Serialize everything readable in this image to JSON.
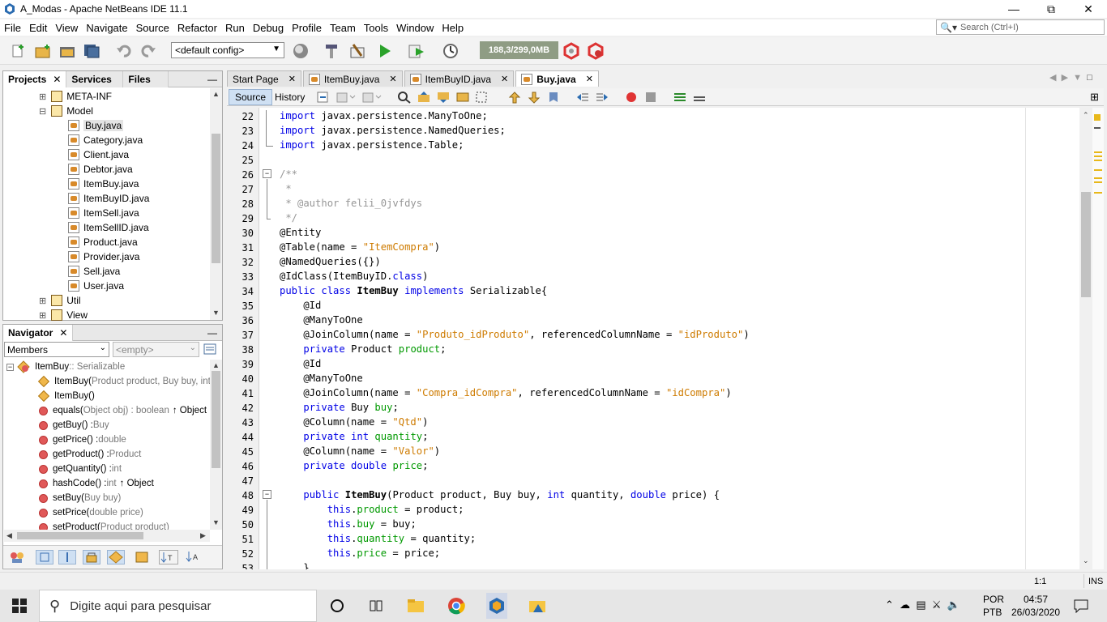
{
  "window": {
    "title": "A_Modas - Apache NetBeans IDE 11.1"
  },
  "menu": [
    "File",
    "Edit",
    "View",
    "Navigate",
    "Source",
    "Refactor",
    "Run",
    "Debug",
    "Profile",
    "Team",
    "Tools",
    "Window",
    "Help"
  ],
  "search": {
    "placeholder": "Search (Ctrl+I)"
  },
  "toolbar": {
    "config": "<default config>",
    "memory": "188,3/299,0MB"
  },
  "projects": {
    "tabs": [
      "Projects",
      "Services",
      "Files"
    ],
    "tree": [
      {
        "label": "META-INF",
        "type": "folder",
        "indent": 1
      },
      {
        "label": "Model",
        "type": "folder",
        "indent": 1
      },
      {
        "label": "Buy.java",
        "type": "java",
        "indent": 2,
        "selected": true
      },
      {
        "label": "Category.java",
        "type": "java",
        "indent": 2
      },
      {
        "label": "Client.java",
        "type": "java",
        "indent": 2
      },
      {
        "label": "Debtor.java",
        "type": "java",
        "indent": 2
      },
      {
        "label": "ItemBuy.java",
        "type": "java",
        "indent": 2
      },
      {
        "label": "ItemBuyID.java",
        "type": "java",
        "indent": 2
      },
      {
        "label": "ItemSell.java",
        "type": "java",
        "indent": 2
      },
      {
        "label": "ItemSellID.java",
        "type": "java",
        "indent": 2
      },
      {
        "label": "Product.java",
        "type": "java",
        "indent": 2
      },
      {
        "label": "Provider.java",
        "type": "java",
        "indent": 2
      },
      {
        "label": "Sell.java",
        "type": "java",
        "indent": 2
      },
      {
        "label": "User.java",
        "type": "java",
        "indent": 2
      },
      {
        "label": "Util",
        "type": "folder",
        "indent": 1
      },
      {
        "label": "View",
        "type": "folder",
        "indent": 1
      }
    ]
  },
  "navigator": {
    "title": "Navigator",
    "members_label": "Members",
    "filter": "<empty>",
    "root": {
      "name": "ItemBuy",
      "type": " :: Serializable"
    },
    "items": [
      {
        "name": "ItemBuy(",
        "params": "Product product, Buy buy, int q",
        "ret": "",
        "kind": "ctor"
      },
      {
        "name": "ItemBuy()",
        "params": "",
        "ret": "",
        "kind": "ctor"
      },
      {
        "name": "equals(",
        "params": "Object obj) : boolean",
        "ret": "↑ Object",
        "kind": "method"
      },
      {
        "name": "getBuy() : ",
        "params": "Buy",
        "ret": "",
        "kind": "method"
      },
      {
        "name": "getPrice() : ",
        "params": "double",
        "ret": "",
        "kind": "method"
      },
      {
        "name": "getProduct() : ",
        "params": "Product",
        "ret": "",
        "kind": "method"
      },
      {
        "name": "getQuantity() : ",
        "params": "int",
        "ret": "",
        "kind": "method"
      },
      {
        "name": "hashCode() : ",
        "params": "int",
        "ret": "↑ Object",
        "kind": "method"
      },
      {
        "name": "setBuy(",
        "params": "Buy buy)",
        "ret": "",
        "kind": "method"
      },
      {
        "name": "setPrice(",
        "params": "double price)",
        "ret": "",
        "kind": "method"
      },
      {
        "name": "setProduct(",
        "params": "Product product)",
        "ret": "",
        "kind": "method"
      }
    ]
  },
  "editor": {
    "tabs": [
      {
        "label": "Start Page",
        "active": false
      },
      {
        "label": "ItemBuy.java",
        "active": false
      },
      {
        "label": "ItemBuyID.java",
        "active": false
      },
      {
        "label": "Buy.java",
        "active": true
      }
    ],
    "source_label": "Source",
    "history_label": "History",
    "lines": [
      {
        "n": "22",
        "html": "<span class='kw'>import</span> javax.persistence.ManyToOne;"
      },
      {
        "n": "23",
        "html": "<span class='kw'>import</span> javax.persistence.NamedQueries;"
      },
      {
        "n": "24",
        "html": "<span class='kw'>import</span> javax.persistence.Table;"
      },
      {
        "n": "25",
        "html": ""
      },
      {
        "n": "26",
        "html": "<span class='cm'>/**</span>"
      },
      {
        "n": "27",
        "html": "<span class='cm'> *</span>"
      },
      {
        "n": "28",
        "html": "<span class='cm'> * @author felii_0jvfdys</span>"
      },
      {
        "n": "29",
        "html": "<span class='cm'> */</span>"
      },
      {
        "n": "30",
        "html": "@Entity"
      },
      {
        "n": "31",
        "html": "@Table(name = <span class='str'>\"ItemCompra\"</span>)"
      },
      {
        "n": "32",
        "html": "@NamedQueries({})"
      },
      {
        "n": "33",
        "html": "@IdClass(ItemBuyID.<span class='kw'>class</span>)"
      },
      {
        "n": "34",
        "html": "<span class='kw'>public class</span> <span class='cls'>ItemBuy</span> <span class='kw'>implements</span> Serializable{"
      },
      {
        "n": "35",
        "html": "    @Id"
      },
      {
        "n": "36",
        "html": "    @ManyToOne"
      },
      {
        "n": "37",
        "html": "    @JoinColumn(name = <span class='str'>\"Produto_idProduto\"</span>, referencedColumnName = <span class='str'>\"idProduto\"</span>)"
      },
      {
        "n": "38",
        "html": "    <span class='kw'>private</span> Product <span class='fld'>product</span>;"
      },
      {
        "n": "39",
        "html": "    @Id"
      },
      {
        "n": "40",
        "html": "    @ManyToOne"
      },
      {
        "n": "41",
        "html": "    @JoinColumn(name = <span class='str'>\"Compra_idCompra\"</span>, referencedColumnName = <span class='str'>\"idCompra\"</span>)"
      },
      {
        "n": "42",
        "html": "    <span class='kw'>private</span> Buy <span class='fld'>buy</span>;"
      },
      {
        "n": "43",
        "html": "    @Column(name = <span class='str'>\"Qtd\"</span>)"
      },
      {
        "n": "44",
        "html": "    <span class='kw'>private int</span> <span class='fld'>quantity</span>;"
      },
      {
        "n": "45",
        "html": "    @Column(name = <span class='str'>\"Valor\"</span>)"
      },
      {
        "n": "46",
        "html": "    <span class='kw'>private double</span> <span class='fld'>price</span>;"
      },
      {
        "n": "47",
        "html": ""
      },
      {
        "n": "48",
        "html": "    <span class='kw'>public</span> <span class='cls'>ItemBuy</span>(Product product, Buy buy, <span class='kw'>int</span> quantity, <span class='kw'>double</span> price) {"
      },
      {
        "n": "49",
        "html": "        <span class='kw'>this</span>.<span class='fld'>product</span> = product;"
      },
      {
        "n": "50",
        "html": "        <span class='kw'>this</span>.<span class='fld'>buy</span> = buy;"
      },
      {
        "n": "51",
        "html": "        <span class='kw'>this</span>.<span class='fld'>quantity</span> = quantity;"
      },
      {
        "n": "52",
        "html": "        <span class='kw'>this</span>.<span class='fld'>price</span> = price;"
      },
      {
        "n": "53",
        "html": "    }"
      }
    ]
  },
  "status": {
    "position": "1:1",
    "mode": "INS"
  },
  "taskbar": {
    "search_placeholder": "Digite aqui para pesquisar",
    "lang1": "POR",
    "lang2": "PTB",
    "time": "04:57",
    "date": "26/03/2020"
  }
}
